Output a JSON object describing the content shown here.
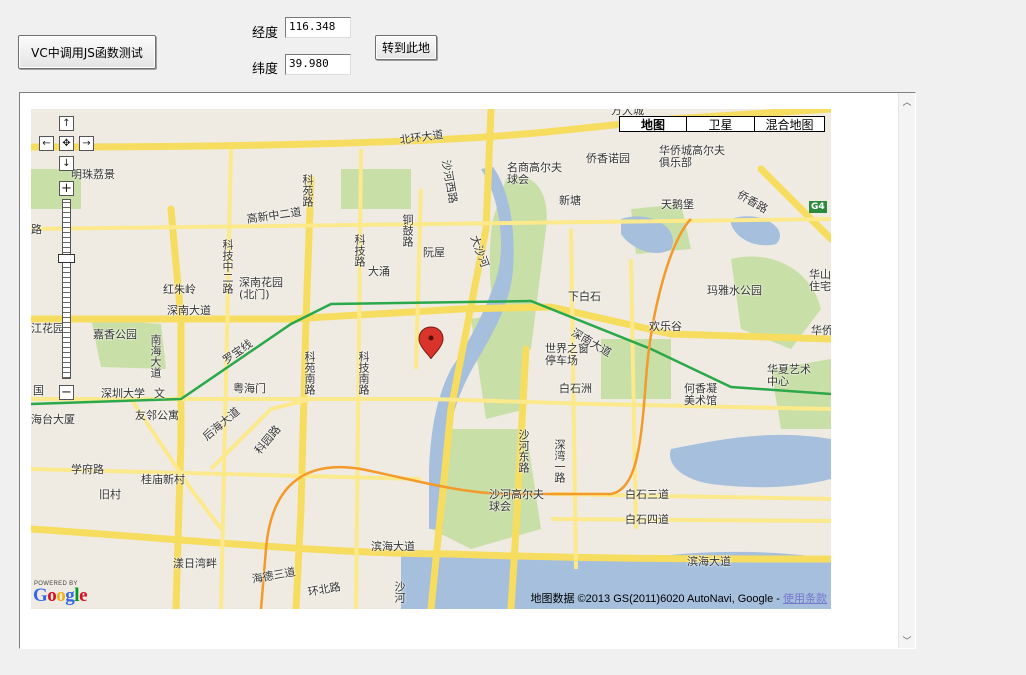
{
  "controls": {
    "call_js_button": "VC中调用JS函数测试",
    "longitude_label": "经度",
    "longitude_value": "116.348",
    "latitude_label": "纬度",
    "latitude_value": "39.980",
    "goto_button": "转到此地"
  },
  "map": {
    "types": [
      "地图",
      "卫星",
      "混合地图"
    ],
    "selected_type": "地图",
    "copyright_prefix": "地图数据 ©2013 GS(2011)6020 AutoNavi, Google - ",
    "terms_link": "使用条款",
    "powered_by": "POWERED BY",
    "logo_text": "Google",
    "logo_colors": [
      "#3369e8",
      "#d50f25",
      "#eeb211",
      "#3369e8",
      "#009925",
      "#d50f25"
    ],
    "labels": [
      {
        "name": "label-beihuan",
        "text": "北环大道"
      },
      {
        "name": "label-fangdachang",
        "text": "方大城"
      },
      {
        "name": "label-mingzhu",
        "text": "明珠荔景"
      },
      {
        "name": "label-mingshang",
        "text": "名商高尔夫\n球会"
      },
      {
        "name": "label-qiaoxiangnuo",
        "text": "侨香诺园"
      },
      {
        "name": "label-huaqiaocheng",
        "text": "华侨城高尔夫\n俱乐部"
      },
      {
        "name": "label-qiaoxiang-road",
        "text": "侨香路"
      },
      {
        "name": "label-xinxiang",
        "text": "新塘"
      },
      {
        "name": "label-tianepu",
        "text": "天鹅堡"
      },
      {
        "name": "label-kejibei",
        "text": "科苑路"
      },
      {
        "name": "label-gaoxinzhong",
        "text": "高新中二道"
      },
      {
        "name": "label-tonggu",
        "text": "铜鼓路"
      },
      {
        "name": "label-shahexi",
        "text": "沙河西路"
      },
      {
        "name": "label-dashahe",
        "text": "大沙河"
      },
      {
        "name": "label-kejizhong",
        "text": "科技中二路"
      },
      {
        "name": "label-kejilu",
        "text": "科技路"
      },
      {
        "name": "label-ruanwu",
        "text": "阮屋"
      },
      {
        "name": "label-datong",
        "text": "大涌"
      },
      {
        "name": "label-hongzhuling",
        "text": "红朱岭"
      },
      {
        "name": "label-shenhua",
        "text": "深南花园\n(北门)"
      },
      {
        "name": "label-xiabaishi",
        "text": "下白石"
      },
      {
        "name": "label-mayashui",
        "text": "玛雅水公园"
      },
      {
        "name": "label-huashan",
        "text": "华山\n住宅"
      },
      {
        "name": "label-shennan-w",
        "text": "深南大道"
      },
      {
        "name": "label-shennan-e",
        "text": "深南大道"
      },
      {
        "name": "label-huanlegu",
        "text": "欢乐谷"
      },
      {
        "name": "label-jiaxiang",
        "text": "嘉香公园"
      },
      {
        "name": "label-nanhai",
        "text": "南海大道"
      },
      {
        "name": "label-huahuayuan",
        "text": "江花园"
      },
      {
        "name": "label-luobao",
        "text": "罗宝线"
      },
      {
        "name": "label-kejinan",
        "text": "科苑南路"
      },
      {
        "name": "label-kejinanlu",
        "text": "科技南路"
      },
      {
        "name": "label-shijie",
        "text": "世界之窗\n停车场"
      },
      {
        "name": "label-huaxia",
        "text": "华夏艺术\n中心"
      },
      {
        "name": "label-huabao",
        "text": "华侨"
      },
      {
        "name": "label-baishizhou",
        "text": "白石洲"
      },
      {
        "name": "label-hexiangning",
        "text": "何香凝\n美术馆"
      },
      {
        "name": "label-yuehaimen",
        "text": "粤海门"
      },
      {
        "name": "label-szdx",
        "text": "深圳大学"
      },
      {
        "name": "label-wen",
        "text": "文"
      },
      {
        "name": "label-guo",
        "text": "国"
      },
      {
        "name": "label-youlin",
        "text": "友邻公寓"
      },
      {
        "name": "label-haitai",
        "text": "海台大厦"
      },
      {
        "name": "label-houhai",
        "text": "后海大道"
      },
      {
        "name": "label-keyuan",
        "text": "科园路"
      },
      {
        "name": "label-shahedong",
        "text": "沙河东路"
      },
      {
        "name": "label-shenwan",
        "text": "深湾一路"
      },
      {
        "name": "label-xuefu",
        "text": "学府路"
      },
      {
        "name": "label-guimiao",
        "text": "桂庙新村"
      },
      {
        "name": "label-jiucun",
        "text": "旧村"
      },
      {
        "name": "label-shahegolf",
        "text": "沙河高尔夫\n球会"
      },
      {
        "name": "label-baishisan",
        "text": "白石三道"
      },
      {
        "name": "label-baishisi",
        "text": "白石四道"
      },
      {
        "name": "label-binhai-w",
        "text": "滨海大道"
      },
      {
        "name": "label-binhai-e",
        "text": "滨海大道"
      },
      {
        "name": "label-shangri",
        "text": "漾日湾畔"
      },
      {
        "name": "label-haide",
        "text": "海德三道"
      },
      {
        "name": "label-huanbei",
        "text": "环北路"
      },
      {
        "name": "label-shahe-s",
        "text": "沙河"
      },
      {
        "name": "label-g4",
        "text": "G4"
      },
      {
        "name": "label-bi",
        "text": "路"
      }
    ]
  }
}
